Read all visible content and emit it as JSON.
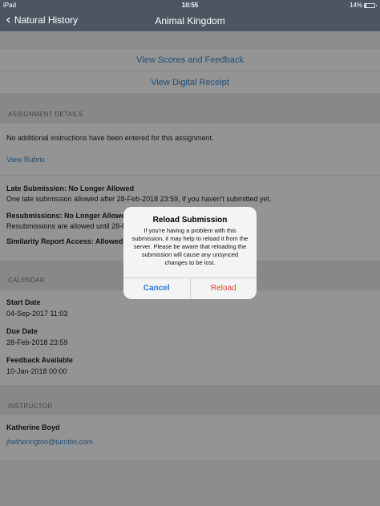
{
  "status_bar": {
    "device": "iPad",
    "wifi_icon": "wifi-icon",
    "time": "10:55",
    "battery": "14%",
    "battery_level": 0.14
  },
  "nav": {
    "back_label": "Natural History",
    "title": "Animal Kingdom",
    "back_icon": "chevron-left-icon"
  },
  "actions": {
    "view_scores": "View Scores and Feedback",
    "view_receipt": "View Digital Receipt"
  },
  "assignment_details": {
    "header": "ASSIGNMENT DETAILS",
    "instructions": "No additional instructions have been entered for this assignment.",
    "view_rubric": "View Rubric",
    "late_title": "Late Submission: No Longer Allowed",
    "late_text": "One late submission allowed after 28-Feb-2018 23:59, if you haven't submitted yet.",
    "resub_title": "Resubmissions: No Longer Allowed",
    "resub_text": "Resubmissions are allowed until 28-F",
    "similarity_title": "Similarity Report Access: Allowed"
  },
  "calendar": {
    "header": "CALENDAR",
    "items": [
      {
        "label": "Start Date",
        "value": "04-Sep-2017 11:03"
      },
      {
        "label": "Due Date",
        "value": "28-Feb-2018 23:59"
      },
      {
        "label": "Feedback Available",
        "value": "10-Jan-2018 00:00"
      }
    ]
  },
  "instructor": {
    "header": "INSTRUCTOR",
    "name": "Katherine Boyd",
    "email": "jhetherington@turnitin.com"
  },
  "dialog": {
    "title": "Reload Submission",
    "message": "If you're having a problem with this submission, it may help to reload it from the server. Please be aware that reloading the submission will cause any unsynced changes to be lost.",
    "cancel": "Cancel",
    "reload": "Reload"
  }
}
